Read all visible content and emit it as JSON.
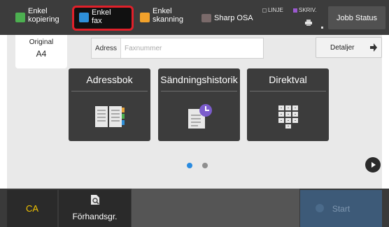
{
  "tabs": [
    {
      "line1": "Enkel",
      "line2": "kopiering"
    },
    {
      "line1": "Enkel",
      "line2": "fax"
    },
    {
      "line1": "Enkel",
      "line2": "skanning"
    },
    {
      "line1": "Sharp OSA",
      "line2": ""
    }
  ],
  "status": {
    "line": "LINJE",
    "print": "SKRIV."
  },
  "job_status_label": "Jobb Status",
  "original": {
    "label": "Original",
    "value": "A4"
  },
  "address": {
    "label": "Adress",
    "placeholder": "Faxnummer",
    "value": ""
  },
  "details_label": "Detaljer",
  "big_buttons": [
    {
      "label": "Adressbok",
      "icon": "address-book-icon"
    },
    {
      "label": "Sändningshistorik",
      "icon": "send-history-icon"
    },
    {
      "label": "Direktval",
      "icon": "speed-dial-keypad-icon"
    }
  ],
  "pager": {
    "current_page": 1,
    "total_pages": 2
  },
  "bottom": {
    "ca_label": "CA",
    "preview_label": "Förhandsgr.",
    "start_label": "Start"
  },
  "colors": {
    "active_tab_border": "#e0202a",
    "active_dot": "#2a8be0",
    "ca_text": "#f2c400",
    "start_bg": "#3d5a78"
  }
}
